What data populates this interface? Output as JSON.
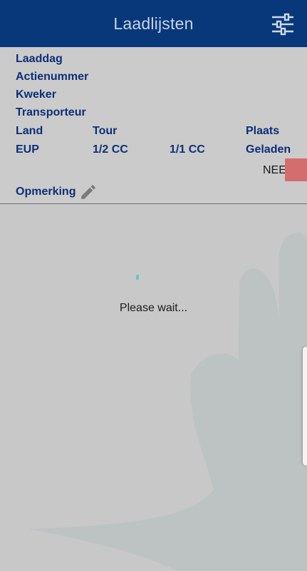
{
  "app_bar": {
    "title": "Laadlijsten",
    "filter_icon": "sliders-icon",
    "background": "#08387a"
  },
  "info": {
    "laaddag_label": "Laaddag",
    "actienummer_label": "Actienummer",
    "kweker_label": "Kweker",
    "transporteur_label": "Transporteur",
    "land_label": "Land",
    "tour_label": "Tour",
    "plaats_label": "Plaats",
    "eup_label": "EUP",
    "half_cc_label": "1/2 CC",
    "full_cc_label": "1/1 CC",
    "geladen_label": "Geladen",
    "geladen_value": "NEE",
    "geladen_status_color": "#d46e6e",
    "opmerking_label": "Opmerking",
    "edit_icon": "pencil-icon"
  },
  "loading": {
    "message": "Please wait...",
    "spinner_color": "#66c8c0"
  }
}
